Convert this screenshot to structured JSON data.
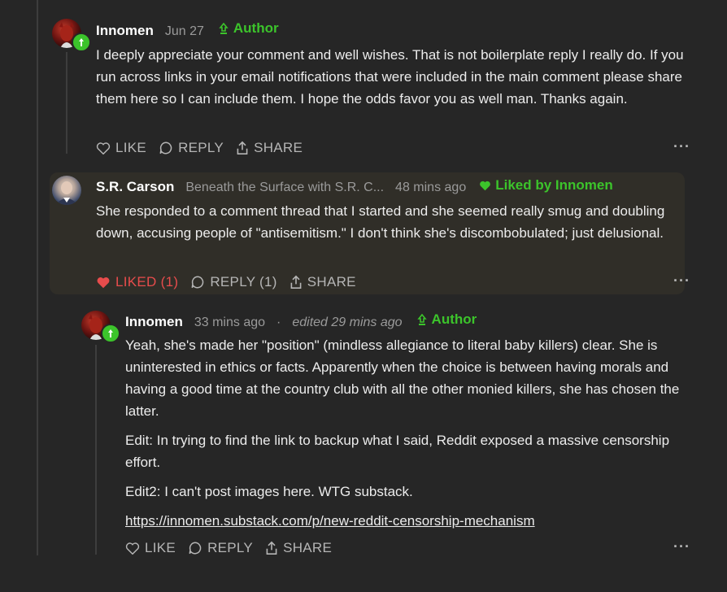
{
  "comments": [
    {
      "author": "Innomen",
      "date": "Jun 27",
      "author_tag": "Author",
      "body": [
        "I deeply appreciate your comment and well wishes. That is not boilerplate reply I really do. If you run across links in your email notifications that were included in the main comment please share them here so I can include them. I hope the odds favor you as well man. Thanks again."
      ],
      "actions": {
        "like": "LIKE",
        "reply": "REPLY",
        "share": "SHARE"
      },
      "more": "···"
    },
    {
      "author": "S.R. Carson",
      "publication": "Beneath the Surface with S.R. C...",
      "date": "48 mins ago",
      "liked_by": "Liked by Innomen",
      "body": [
        "She responded to a comment thread that I started and she seemed really smug and doubling down, accusing people of \"antisemitism.\" I don't think she's discombobulated; just delusional."
      ],
      "actions": {
        "like": "LIKED (1)",
        "reply": "REPLY (1)",
        "share": "SHARE"
      },
      "more": "···"
    },
    {
      "author": "Innomen",
      "date": "33 mins ago",
      "separator": "·",
      "edited": "edited 29 mins ago",
      "author_tag": "Author",
      "body": [
        "Yeah, she's made her \"position\" (mindless allegiance to literal baby killers) clear. She is uninterested in ethics or facts. Apparently when the choice is between having morals and having a good time at the country club with all the other monied killers, she has chosen the latter.",
        "Edit: In trying to find the link to backup what I said, Reddit exposed a massive censorship effort.",
        "Edit2: I can't post images here. WTG substack."
      ],
      "link": "https://innomen.substack.com/p/new-reddit-censorship-mechanism",
      "actions": {
        "like": "LIKE",
        "reply": "REPLY",
        "share": "SHARE"
      },
      "more": "···"
    }
  ],
  "colors": {
    "accent": "#3cc42b",
    "liked": "#e74c4c",
    "background": "#262626"
  }
}
